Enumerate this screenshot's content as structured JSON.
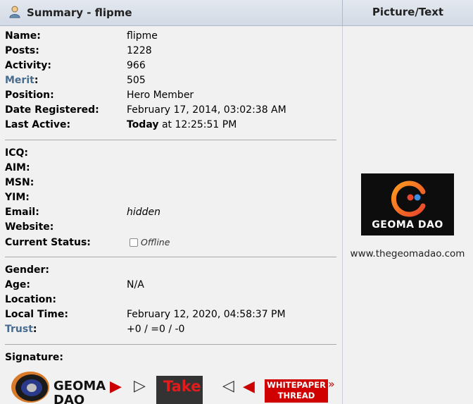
{
  "header": {
    "left_title": "Summary - flipme",
    "right_title": "Picture/Text"
  },
  "profile": {
    "basic": [
      {
        "label": "Name:",
        "value": "flipme"
      },
      {
        "label": "Posts:",
        "value": "1228"
      },
      {
        "label": "Activity:",
        "value": "966"
      },
      {
        "label": "Merit",
        "value": "505"
      },
      {
        "label": "Position:",
        "value": "Hero Member"
      },
      {
        "label": "Date Registered:",
        "value": "February 17, 2014, 03:02:38 AM"
      },
      {
        "label": "Last Active:",
        "value_bold": "Today",
        "value": "at 12:25:51 PM"
      }
    ],
    "contact": [
      {
        "label": "ICQ:",
        "value": ""
      },
      {
        "label": "AIM:",
        "value": ""
      },
      {
        "label": "MSN:",
        "value": ""
      },
      {
        "label": "YIM:",
        "value": ""
      },
      {
        "label": "Email:",
        "value": "hidden"
      },
      {
        "label": "Website:",
        "value": ""
      },
      {
        "label": "Current Status:",
        "value": "Offline"
      }
    ],
    "personal": [
      {
        "label": "Gender:",
        "value": ""
      },
      {
        "label": "Age:",
        "value": "N/A"
      },
      {
        "label": "Location:",
        "value": ""
      },
      {
        "label": "Local Time:",
        "value": "February 12, 2020, 04:58:37 PM"
      },
      {
        "label": "Trust",
        "value": "+0 / =0 / -0"
      }
    ],
    "signature_label": "Signature:",
    "merit_colon": ":",
    "trust_colon": ":"
  },
  "picture": {
    "logo_text": "GEOMA DAO",
    "website": "www.thegeomadao.com"
  },
  "signature": {
    "geoma_line1": "GEOMA",
    "geoma_line2": "DAO",
    "take_text": "Take",
    "whitepaper_line1": "WHITEPAPER",
    "whitepaper_line2": "THREAD"
  },
  "colors": {
    "link": "#476c8e",
    "accent_red": "#d10000"
  }
}
